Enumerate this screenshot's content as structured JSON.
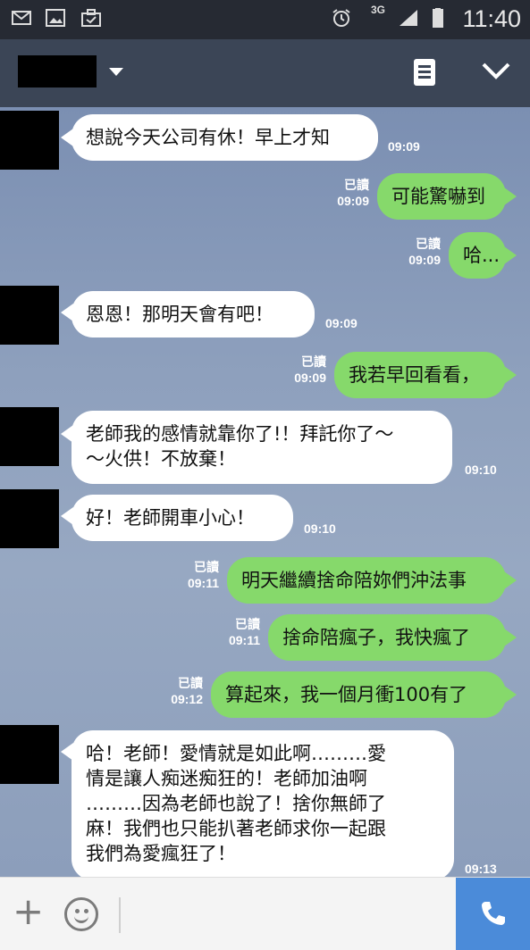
{
  "status_bar": {
    "time": "11:40",
    "network": "3G",
    "icons": [
      "mail-icon",
      "gallery-icon",
      "briefcase-icon",
      "alarm-icon",
      "signal-icon",
      "battery-icon"
    ]
  },
  "header": {
    "icons": [
      "dropdown-arrow-icon",
      "notes-icon",
      "chevron-down-icon"
    ]
  },
  "messages": [
    {
      "dir": "in",
      "text": "想說今天公司有休！早上才知",
      "time": "09:09"
    },
    {
      "dir": "out",
      "text": "可能驚嚇到",
      "read": "已讀",
      "time": "09:09"
    },
    {
      "dir": "out",
      "text": "哈...",
      "read": "已讀",
      "time": "09:09"
    },
    {
      "dir": "in",
      "text": "恩恩！那明天會有吧！",
      "time": "09:09"
    },
    {
      "dir": "out",
      "text": "我若早回看看，",
      "read": "已讀",
      "time": "09:09"
    },
    {
      "dir": "in",
      "text": "老師我的感情就靠你了!！拜託你了～\n～火供！不放棄！",
      "time": "09:10"
    },
    {
      "dir": "in",
      "text": "好！老師開車小心！",
      "time": "09:10"
    },
    {
      "dir": "out",
      "text": "明天繼續捨命陪妳們沖法事",
      "read": "已讀",
      "time": "09:11"
    },
    {
      "dir": "out",
      "text": "捨命陪瘋子，我快瘋了",
      "read": "已讀",
      "time": "09:11"
    },
    {
      "dir": "out",
      "text": "算起來，我一個月衝100有了",
      "read": "已讀",
      "time": "09:12"
    },
    {
      "dir": "in",
      "text": "哈！老師！愛情就是如此啊………愛\n情是讓人痴迷痴狂的！老師加油啊\n………因為老師也說了！捨你無師了\n麻！我們也只能扒著老師求你一起跟\n我們為愛瘋狂了！",
      "time": "09:13"
    }
  ],
  "input_bar": {
    "icons": [
      "plus-icon",
      "emoji-icon",
      "phone-icon"
    ]
  },
  "colors": {
    "incoming_bubble": "#ffffff",
    "outgoing_bubble": "#86d96b",
    "header": "#3b4556",
    "call_button": "#4b8bd9"
  }
}
